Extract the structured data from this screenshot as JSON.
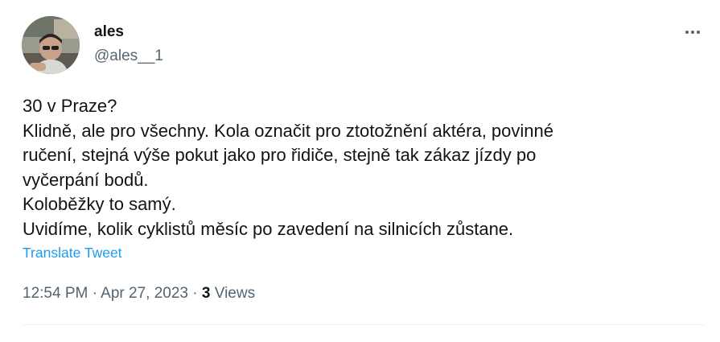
{
  "author": {
    "name": "ales",
    "handle": "@ales__1"
  },
  "more_icon": "more-horizontal-icon",
  "tweet_text": [
    "30 v Praze?",
    "Klidně, ale pro všechny. Kola označit pro ztotožnění aktéra, povinné",
    "ručení, stejná výše pokut jako pro řidiče, stejně tak zákaz jízdy po",
    "vyčerpání bodů.",
    "Koloběžky to samý.",
    "Uvidíme, kolik cyklistů měsíc po zavedení na silnicích zůstane."
  ],
  "translate_label": "Translate Tweet",
  "meta": {
    "time": "12:54 PM",
    "separator": " · ",
    "date": "Apr 27, 2023",
    "views_count": "3",
    "views_label": "Views"
  },
  "colors": {
    "text": "#0f1419",
    "secondary": "#536471",
    "link": "#1d9bf0"
  }
}
